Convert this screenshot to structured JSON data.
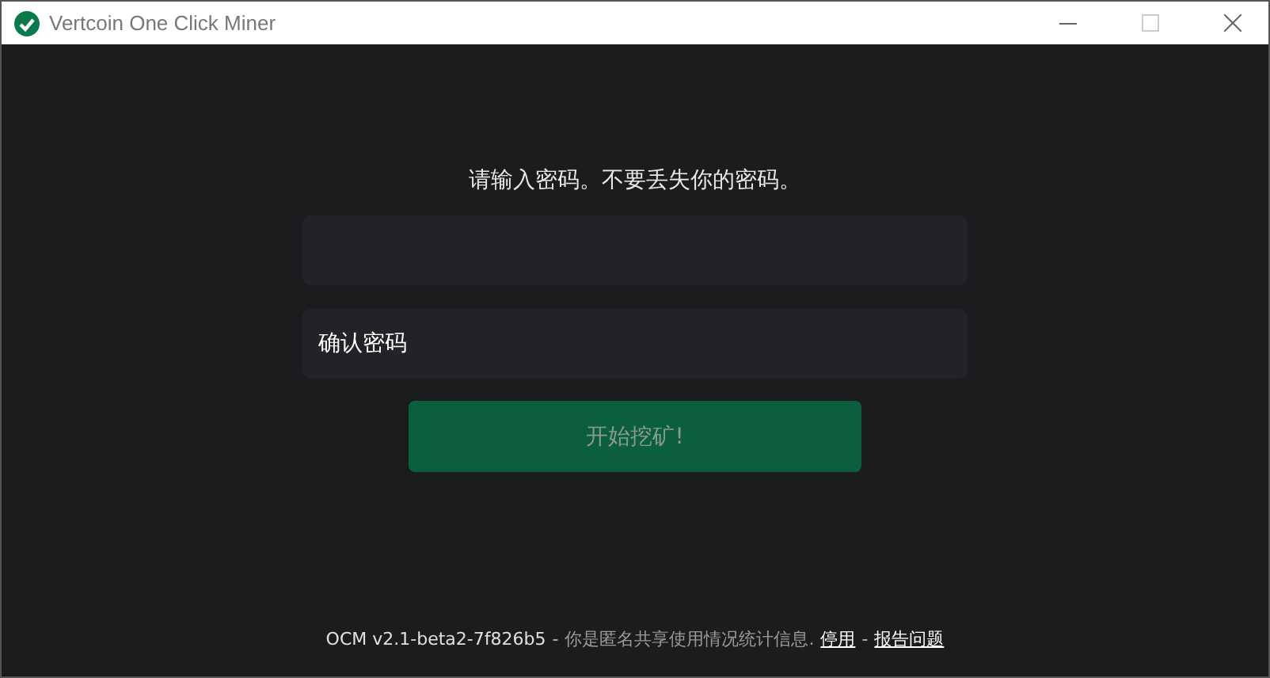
{
  "window": {
    "title": "Vertcoin One Click Miner"
  },
  "prompt": "请输入密码。不要丢失你的密码。",
  "confirm_field": {
    "placeholder": "确认密码"
  },
  "start_button": {
    "label": "开始挖矿!",
    "disabled": true
  },
  "footer": {
    "version": "OCM v2.1-beta2-7f826b5",
    "separator_1": "-",
    "notice": "你是匿名共享使用情况统计信息.",
    "disable_link": "停用",
    "separator_2": "-",
    "report_link": "报告问题"
  }
}
